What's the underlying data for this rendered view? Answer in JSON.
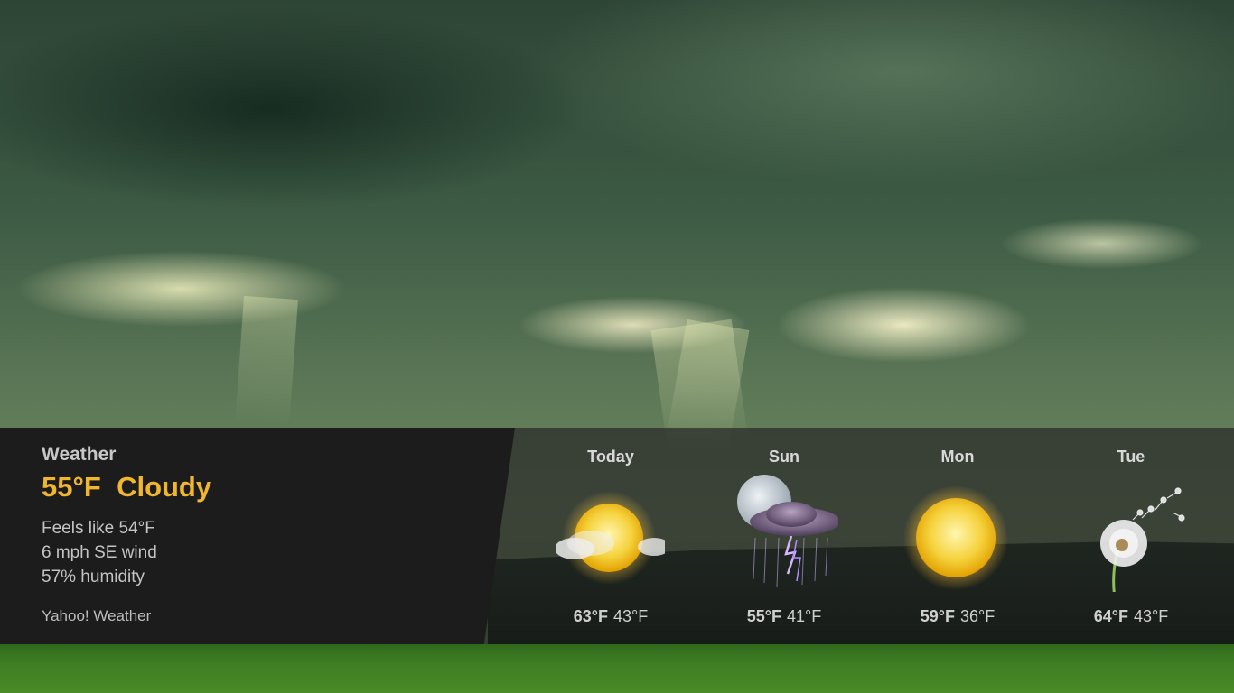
{
  "current": {
    "app_title": "Weather",
    "temperature": "55°F",
    "condition": "Cloudy",
    "feels_like": "Feels like 54°F",
    "wind": "6 mph SE wind",
    "humidity": "57% humidity",
    "source": "Yahoo! Weather"
  },
  "forecast": [
    {
      "day": "Today",
      "high": "63°F",
      "low": "43°F",
      "icon": "sun-with-clouds-icon"
    },
    {
      "day": "Sun",
      "high": "55°F",
      "low": "41°F",
      "icon": "night-thunderstorm-icon"
    },
    {
      "day": "Mon",
      "high": "59°F",
      "low": "36°F",
      "icon": "sun-icon"
    },
    {
      "day": "Tue",
      "high": "64°F",
      "low": "43°F",
      "icon": "dandelion-windy-icon"
    }
  ],
  "colors": {
    "accent": "#f1b62f",
    "panel": "#1c1c1c",
    "text": "#c4c4c4"
  }
}
